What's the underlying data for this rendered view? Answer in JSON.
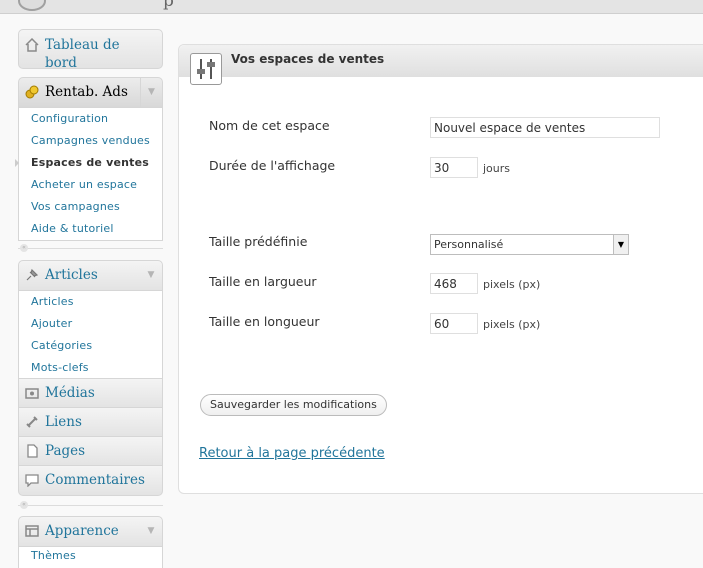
{
  "header": {
    "partial_text": "p"
  },
  "menu": {
    "dashboard": {
      "label": "Tableau de bord",
      "icon": "home-icon"
    },
    "rentab": {
      "label": "Rentab. Ads",
      "icon": "coins-icon",
      "items": [
        "Configuration",
        "Campagnes vendues",
        "Espaces de ventes",
        "Acheter un espace",
        "Vos campagnes",
        "Aide & tutoriel"
      ],
      "current_index": 2
    },
    "articles": {
      "label": "Articles",
      "icon": "pin-icon",
      "items": [
        "Articles",
        "Ajouter",
        "Catégories",
        "Mots-clefs"
      ]
    },
    "medias": {
      "label": "Médias",
      "icon": "media-icon"
    },
    "liens": {
      "label": "Liens",
      "icon": "link-icon"
    },
    "pages": {
      "label": "Pages",
      "icon": "page-icon"
    },
    "commentaires": {
      "label": "Commentaires",
      "icon": "comment-icon"
    },
    "apparence": {
      "label": "Apparence",
      "icon": "appearance-icon",
      "items": [
        "Thèmes"
      ]
    }
  },
  "box": {
    "title": "Vos espaces de ventes",
    "icon": "settings-sliders-icon"
  },
  "form": {
    "name_label": "Nom de cet espace",
    "name_value": "Nouvel espace de ventes",
    "duration_label": "Durée de l'affichage",
    "duration_value": "30",
    "duration_unit": "jours",
    "size_label": "Taille prédéfinie",
    "size_value": "Personnalisé",
    "width_label": "Taille en largueur",
    "width_value": "468",
    "width_unit": "pixels (px)",
    "height_label": "Taille en longueur",
    "height_value": "60",
    "height_unit": "pixels (px)",
    "save_label": "Sauvegarder les modifications",
    "back_label": "Retour à la page précédente"
  },
  "colors": {
    "link": "#21759b",
    "text": "#333333"
  }
}
